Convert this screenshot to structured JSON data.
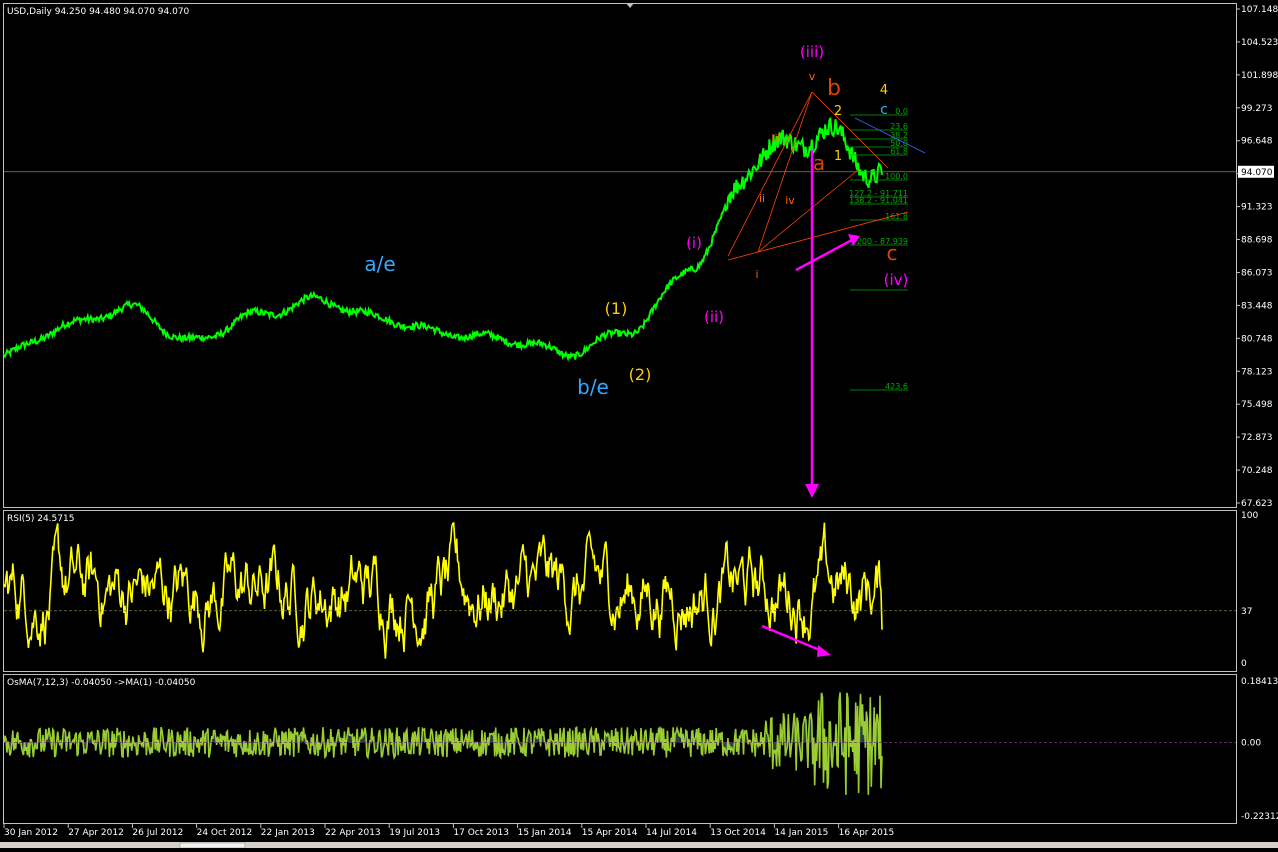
{
  "colors": {
    "background": "#000000",
    "frame": "#c0c0c0",
    "price_line": "#00ff00",
    "rsi_line": "#ffff00",
    "osma_line": "#9acd32",
    "osma_fill": "#2f4f4f",
    "wave_cyan": "#33aaff",
    "wave_yellow": "#ffcc00",
    "wave_magenta": "#ff00ff",
    "wave_orange": "#ff6600",
    "wave_red": "#dd4400",
    "fib_text": "#00aa00",
    "arrow": "#ff00ff",
    "current_price_line": "#808080"
  },
  "header": {
    "main": "USD,Daily  94.250 94.480 94.070 94.070",
    "rsi": "RSI(5) 24.5715",
    "osma": "OsMA(7,12,3) -0.04050  ->MA(1) -0.04050"
  },
  "chart_data": [
    {
      "type": "line",
      "panel": "price",
      "series": [
        {
          "x": [
            "30 Jan 2012",
            "27 Apr 2012",
            "26 Jul 2012",
            "24 Oct 2012",
            "22 Jan 2013",
            "22 Apr 2013",
            "19 Jul 2013",
            "17 Oct 2013",
            "15 Jan 2014",
            "15 Apr 2014",
            "14 Jul 2014",
            "13 Oct 2014",
            "14 Jan 2015",
            "16 Apr 2015",
            "7 May 2015"
          ],
          "values": [
            79.4,
            81.8,
            83.2,
            80.5,
            82.6,
            83.8,
            82.4,
            81.2,
            80.7,
            79.6,
            81.4,
            86.6,
            95.2,
            97.2,
            94.07
          ]
        }
      ],
      "ylim": [
        67.623,
        107.148
      ],
      "y_ticks": [
        "107.148",
        "104.523",
        "101.898",
        "99.273",
        "96.648",
        "94.023",
        "91.323",
        "88.698",
        "86.073",
        "83.448",
        "80.748",
        "78.123",
        "75.498",
        "72.873",
        "70.248",
        "67.623"
      ],
      "current_price": "94.070",
      "wave_labels": [
        {
          "text": "a/e",
          "color": "cyan"
        },
        {
          "text": "b/e",
          "color": "cyan"
        },
        {
          "text": "(1)",
          "color": "yellow"
        },
        {
          "text": "(2)",
          "color": "yellow"
        },
        {
          "text": "(i)",
          "color": "magenta"
        },
        {
          "text": "(ii)",
          "color": "magenta"
        },
        {
          "text": "(iii)",
          "color": "magenta"
        },
        {
          "text": "(iv)",
          "color": "magenta"
        },
        {
          "text": "i",
          "color": "orange"
        },
        {
          "text": "ii",
          "color": "orange"
        },
        {
          "text": "iii",
          "color": "orange"
        },
        {
          "text": "iv",
          "color": "orange"
        },
        {
          "text": "v",
          "color": "orange"
        },
        {
          "text": "a",
          "color": "red"
        },
        {
          "text": "b",
          "color": "red"
        },
        {
          "text": "c",
          "color": "red"
        },
        {
          "text": "4",
          "color": "yellow"
        },
        {
          "text": "c",
          "color": "cyan"
        },
        {
          "text": "1",
          "color": "yellow"
        },
        {
          "text": "2",
          "color": "yellow"
        }
      ],
      "fib_levels": [
        "0.0",
        "23.6",
        "38.2",
        "50.0",
        "61.8",
        "100.0",
        "127.2 - 91.711",
        "138.2 - 91.041",
        "161.8",
        "200 - 87.939",
        "423.6"
      ]
    },
    {
      "type": "line",
      "panel": "rsi",
      "series": [
        {
          "name": "RSI(5)",
          "last_value": 24.5715
        }
      ],
      "ylim": [
        0,
        100
      ],
      "y_ticks": [
        "100",
        "37",
        "0"
      ],
      "level": 37
    },
    {
      "type": "line",
      "panel": "osma",
      "series": [
        {
          "name": "OsMA(7,12,3)",
          "last_value": -0.0405
        }
      ],
      "ylim": [
        -0.22312,
        0.18413
      ],
      "y_ticks": [
        "0.18413",
        "0.00",
        "-0.22312"
      ]
    }
  ],
  "x_axis": {
    "labels": [
      "30 Jan 2012",
      "27 Apr 2012",
      "26 Jul 2012",
      "24 Oct 2012",
      "22 Jan 2013",
      "22 Apr 2013",
      "19 Jul 2013",
      "17 Oct 2013",
      "15 Jan 2014",
      "15 Apr 2014",
      "14 Jul 2014",
      "13 Oct 2014",
      "14 Jan 2015",
      "16 Apr 2015"
    ]
  }
}
